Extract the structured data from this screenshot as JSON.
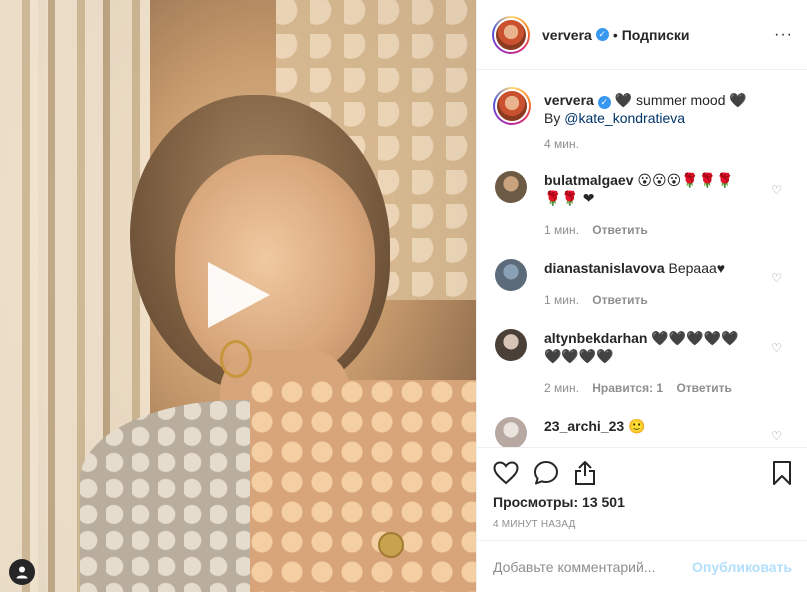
{
  "header": {
    "username": "ververa",
    "separator": "•",
    "follow_label": "Подписки",
    "more": "···"
  },
  "caption": {
    "username": "ververa",
    "text": "🖤 summer mood 🖤",
    "by_prefix": "By ",
    "mention": "@kate_kondratieva",
    "time": "4 мин."
  },
  "comments": [
    {
      "username": "bulatmalgaev",
      "text": "😮😮😮🌹🌹🌹🌹🌹 ❤",
      "time": "1 мин.",
      "likes": "",
      "reply": "Ответить",
      "avatar_color": "#6d5a45"
    },
    {
      "username": "dianastanislavova",
      "text": "Вераaa♥",
      "time": "1 мин.",
      "likes": "",
      "reply": "Ответить",
      "avatar_color": "#5c6b7a"
    },
    {
      "username": "altynbekdarhan",
      "text": "🖤🖤🖤🖤🖤🖤🖤🖤🖤",
      "time": "2 мин.",
      "likes": "Нравится: 1",
      "reply": "Ответить",
      "avatar_color": "#4a4038"
    },
    {
      "username": "23_archi_23",
      "text": "🙂",
      "time": "",
      "likes": "",
      "reply": "",
      "avatar_color": "#b7a9a2"
    }
  ],
  "stats": {
    "views": "Просмотры: 13 501",
    "timeago": "4 МИНУТ НАЗАД"
  },
  "add_comment": {
    "placeholder": "Добавьте комментарий...",
    "post_label": "Опубликовать"
  },
  "colors": {
    "verified": "#3897f0",
    "post_disabled": "#b2dffc",
    "meta_gray": "#8e8e8e"
  },
  "icons": [
    "play-icon",
    "user-tag-icon",
    "verified-icon",
    "more-icon",
    "heart-icon",
    "comment-icon",
    "share-icon",
    "bookmark-icon"
  ]
}
